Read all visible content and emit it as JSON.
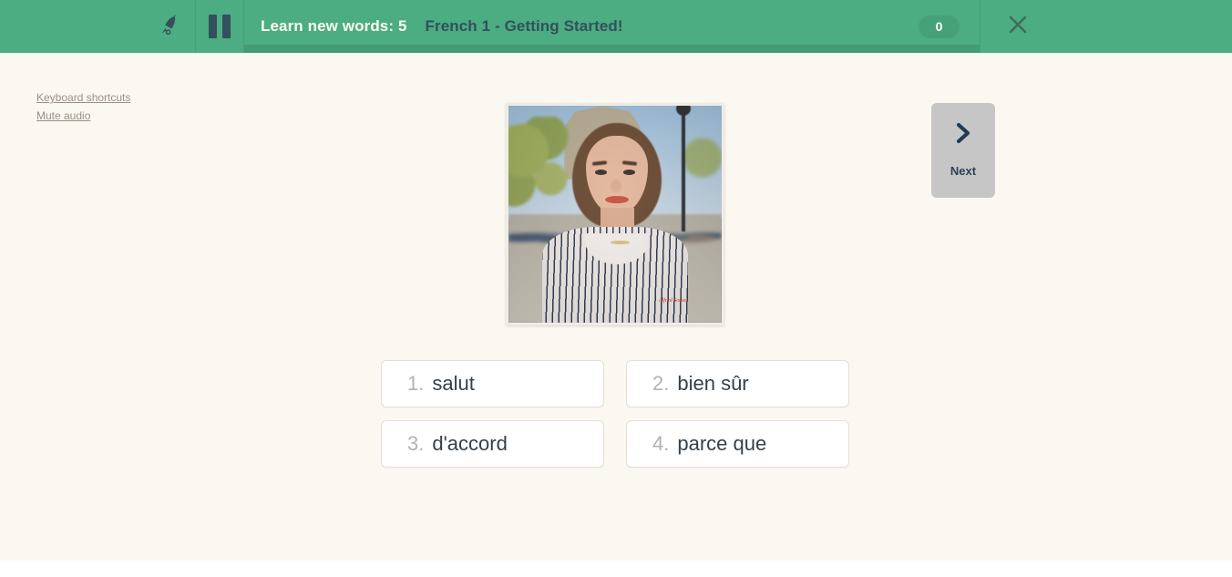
{
  "header": {
    "rocket_icon": "rocket-icon",
    "pause_icon": "pause-icon",
    "lesson_counter_label": "Learn new words: 5",
    "course_title": "French 1 - Getting Started!",
    "score": "0",
    "close_icon": "close-icon",
    "progress_percent": 100
  },
  "side_links": [
    {
      "label": "Keyboard shortcuts",
      "name": "keyboard-shortcuts-link"
    },
    {
      "label": "Mute audio",
      "name": "mute-audio-link"
    }
  ],
  "prompt": {
    "image_alt": "Young woman smiling on the Champs-Elysees with the Arc de Triomphe behind her",
    "image_watermark": "Alfred Soussi"
  },
  "next_button": {
    "label": "Next",
    "icon": "chevron-right-icon"
  },
  "options": [
    {
      "number": "1.",
      "text": "salut"
    },
    {
      "number": "2.",
      "text": "bien sûr"
    },
    {
      "number": "3.",
      "text": "d'accord"
    },
    {
      "number": "4.",
      "text": "parce que"
    }
  ],
  "colors": {
    "header_green": "#4cac82",
    "progress_green": "#449a74",
    "page_background": "#fbf8f2",
    "dark_slate": "#33505c",
    "option_text": "#34404a",
    "option_number": "#b5b1ac",
    "next_button_bg": "#c6c6c6"
  }
}
